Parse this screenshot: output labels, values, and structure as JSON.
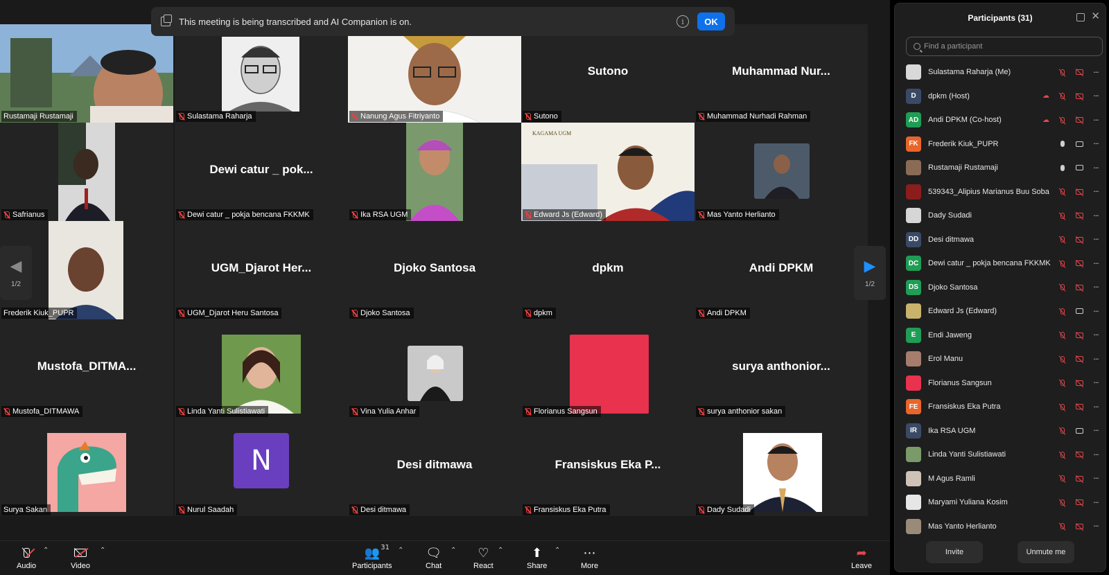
{
  "banner": {
    "text": "This meeting is being transcribed and AI Companion is on.",
    "ok_label": "OK"
  },
  "gallery": {
    "page_indicator_prev": "1/2",
    "page_indicator_next": "1/2",
    "tiles": [
      {
        "label": "Rustamaji Rustamaji",
        "big": ""
      },
      {
        "label": "Sulastama Raharja",
        "big": ""
      },
      {
        "label": "Nanung Agus Fitriyanto",
        "big": ""
      },
      {
        "label": "Sutono",
        "big": "Sutono"
      },
      {
        "label": "Muhammad Nurhadi Rahman",
        "big": "Muhammad  Nur..."
      },
      {
        "label": "Safrianus",
        "big": ""
      },
      {
        "label": "Dewi catur _ pokja bencana FKKMK",
        "big": "Dewi catur _ pok..."
      },
      {
        "label": "Ika RSA UGM",
        "big": ""
      },
      {
        "label": "Edward Js (Edward)",
        "big": ""
      },
      {
        "label": "Mas Yanto Herlianto",
        "big": ""
      },
      {
        "label": "Frederik Kiuk_PUPR",
        "big": ""
      },
      {
        "label": "UGM_Djarot Heru Santosa",
        "big": "UGM_Djarot  Her..."
      },
      {
        "label": "Djoko Santosa",
        "big": "Djoko Santosa"
      },
      {
        "label": "dpkm",
        "big": "dpkm"
      },
      {
        "label": "Andi DPKM",
        "big": "Andi DPKM"
      },
      {
        "label": "Mustofa_DITMAWA",
        "big": "Mustofa_DITMA..."
      },
      {
        "label": "Linda Yanti Sulistiawati",
        "big": ""
      },
      {
        "label": "Vina Yulia Anhar",
        "big": ""
      },
      {
        "label": "Florianus Sangsun",
        "big": ""
      },
      {
        "label": "surya anthonior sakan",
        "big": "surya  anthonior..."
      },
      {
        "label": "Surya Sakan",
        "big": ""
      },
      {
        "label": "Nurul Saadah",
        "big": ""
      },
      {
        "label": "Desi ditmawa",
        "big": "Desi ditmawa"
      },
      {
        "label": "Fransiskus Eka Putra",
        "big": "Fransiskus Eka P..."
      },
      {
        "label": "Dady Sudadi",
        "big": ""
      }
    ],
    "nurul_avatar_letter": "N",
    "kagama_text": "KAGAMA UGM"
  },
  "toolbar": {
    "audio": "Audio",
    "video": "Video",
    "participants": "Participants",
    "participants_count": "31",
    "chat": "Chat",
    "react": "React",
    "share": "Share",
    "more": "More",
    "leave": "Leave"
  },
  "panel": {
    "title": "Participants (31)",
    "search_placeholder": "Find a participant",
    "invite": "Invite",
    "unmute": "Unmute me",
    "participants": [
      {
        "name": "Sulastama Raharja (Me)",
        "initials": "",
        "color": "#d9d9d9",
        "rec": false,
        "mic": "off",
        "cam": "off"
      },
      {
        "name": "dpkm (Host)",
        "initials": "D",
        "color": "#3a4a66",
        "rec": true,
        "mic": "off",
        "cam": "off"
      },
      {
        "name": "Andi DPKM (Co-host)",
        "initials": "AD",
        "color": "#1f9d55",
        "rec": true,
        "mic": "off",
        "cam": "off"
      },
      {
        "name": "Frederik Kiuk_PUPR",
        "initials": "FK",
        "color": "#e8652b",
        "rec": false,
        "mic": "on",
        "cam": "on"
      },
      {
        "name": "Rustamaji Rustamaji",
        "initials": "",
        "color": "#8a6b55",
        "rec": false,
        "mic": "on",
        "cam": "on"
      },
      {
        "name": "539343_Alipius Marianus Buu Soba",
        "initials": "",
        "color": "#8c1d1d",
        "rec": false,
        "mic": "off",
        "cam": "off"
      },
      {
        "name": "Dady Sudadi",
        "initials": "",
        "color": "#d6d6d6",
        "rec": false,
        "mic": "off",
        "cam": "off"
      },
      {
        "name": "Desi ditmawa",
        "initials": "DD",
        "color": "#3a4a66",
        "rec": false,
        "mic": "off",
        "cam": "off"
      },
      {
        "name": "Dewi catur _ pokja bencana FKKMK",
        "initials": "DC",
        "color": "#1f9d55",
        "rec": false,
        "mic": "off",
        "cam": "off"
      },
      {
        "name": "Djoko Santosa",
        "initials": "DS",
        "color": "#1f9d55",
        "rec": false,
        "mic": "off",
        "cam": "off"
      },
      {
        "name": "Edward Js (Edward)",
        "initials": "",
        "color": "#c9b26b",
        "rec": false,
        "mic": "off",
        "cam": "on"
      },
      {
        "name": "Endi Jaweng",
        "initials": "E",
        "color": "#1f9d55",
        "rec": false,
        "mic": "off",
        "cam": "off"
      },
      {
        "name": "Erol Manu",
        "initials": "",
        "color": "#a67c6d",
        "rec": false,
        "mic": "off",
        "cam": "off"
      },
      {
        "name": "Florianus Sangsun",
        "initials": "",
        "color": "#e8324e",
        "rec": false,
        "mic": "off",
        "cam": "off"
      },
      {
        "name": "Fransiskus Eka Putra",
        "initials": "FE",
        "color": "#e8652b",
        "rec": false,
        "mic": "off",
        "cam": "off"
      },
      {
        "name": "Ika RSA UGM",
        "initials": "IR",
        "color": "#3a4a66",
        "rec": false,
        "mic": "off",
        "cam": "on"
      },
      {
        "name": "Linda Yanti Sulistiawati",
        "initials": "",
        "color": "#7a9a6a",
        "rec": false,
        "mic": "off",
        "cam": "off"
      },
      {
        "name": "M Agus Ramli",
        "initials": "",
        "color": "#cfc3b8",
        "rec": false,
        "mic": "off",
        "cam": "off"
      },
      {
        "name": "Maryami Yuliana Kosim",
        "initials": "",
        "color": "#e6e6e6",
        "rec": false,
        "mic": "off",
        "cam": "off"
      },
      {
        "name": "Mas Yanto Herlianto",
        "initials": "",
        "color": "#9a8a7a",
        "rec": false,
        "mic": "off",
        "cam": "off"
      }
    ]
  },
  "colors": {
    "accent": "#0e71eb",
    "active_speaker": "#3fcc5b",
    "muted": "#e5484d"
  }
}
